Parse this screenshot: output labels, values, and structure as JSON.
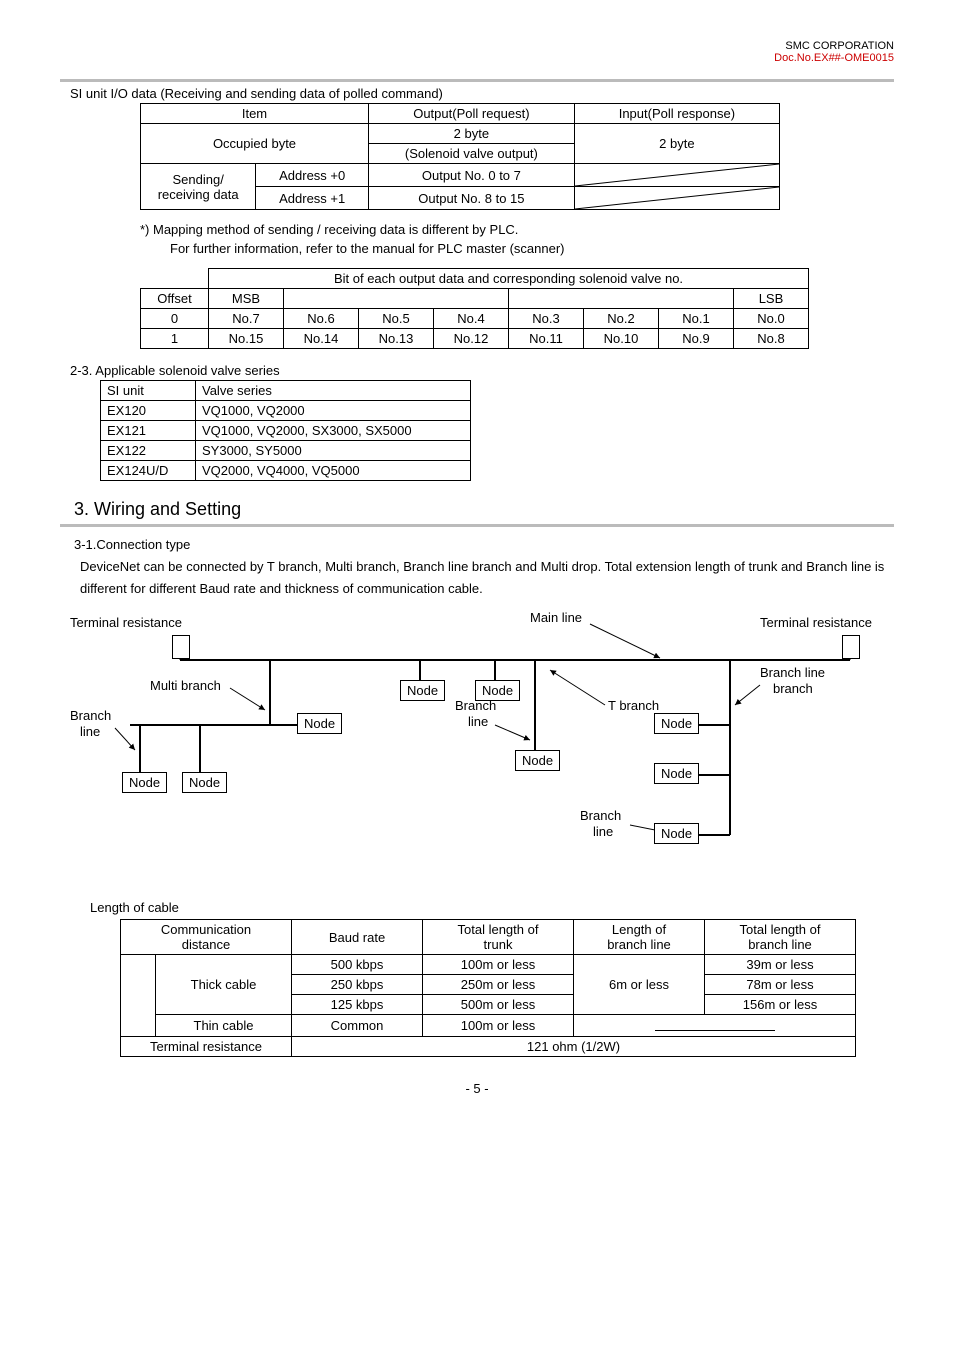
{
  "header": {
    "company": "SMC CORPORATION",
    "docno": "Doc.No.EX##-OME0015"
  },
  "si_unit_title": "SI unit I/O data (Receiving and sending data of polled command)",
  "tbl1": {
    "h_item": "Item",
    "h_out": "Output(Poll request)",
    "h_in": "Input(Poll response)",
    "occupied": "Occupied byte",
    "two_byte": "2 byte",
    "solenoid": "(Solenoid valve output)",
    "sending": "Sending/",
    "receiving": "receiving data",
    "addr0": "Address +0",
    "addr1": "Address +1",
    "out0": "Output No. 0 to 7",
    "out8": "Output No. 8 to 15"
  },
  "note1": "*) Mapping method of sending / receiving data is different by PLC.",
  "note2": "For further information, refer to the manual for PLC master (scanner)",
  "tbl2": {
    "caption": "Bit of each output data and corresponding solenoid valve no.",
    "offset": "Offset",
    "msb": "MSB",
    "lsb": "LSB",
    "r0": [
      "0",
      "No.7",
      "No.6",
      "No.5",
      "No.4",
      "No.3",
      "No.2",
      "No.1",
      "No.0"
    ],
    "r1": [
      "1",
      "No.15",
      "No.14",
      "No.13",
      "No.12",
      "No.11",
      "No.10",
      "No.9",
      "No.8"
    ]
  },
  "applicable_title": "2-3. Applicable solenoid valve series",
  "tbl3": {
    "h0": "SI unit",
    "h1": "Valve series",
    "rows": [
      [
        "EX120",
        "VQ1000, VQ2000"
      ],
      [
        "EX121",
        "VQ1000, VQ2000, SX3000, SX5000"
      ],
      [
        "EX122",
        "SY3000, SY5000"
      ],
      [
        "EX124U/D",
        "VQ2000, VQ4000, VQ5000"
      ]
    ]
  },
  "wiring_title": "3. Wiring and Setting",
  "conn_type": "3-1.Connection type",
  "conn_para": "DeviceNet can be connected by T branch, Multi branch, Branch line branch and Multi drop. Total extension length of trunk and Branch line is different for different Baud rate and thickness of communication cable.",
  "diagram": {
    "terminal_res": "Terminal resistance",
    "main_line": "Main line",
    "multi_branch": "Multi branch",
    "branch_line": "Branch",
    "branch_line2": "line",
    "t_branch": "T branch",
    "branch_line_branch": "Branch line",
    "branch_line_branch2": "branch",
    "node": "Node"
  },
  "len_title": "Length of cable",
  "tbl4": {
    "h_comm": "Communication",
    "h_dist": "distance",
    "h_baud": "Baud rate",
    "h_tot_trunk": "Total length of",
    "h_trunk": "trunk",
    "h_len_branch": "Length of",
    "h_branch_line": "branch line",
    "h_tot_branch": "Total length of",
    "h_tot_branch2": "branch line",
    "thick": "Thick cable",
    "thin": "Thin cable",
    "term_res": "Terminal resistance",
    "b500": "500 kbps",
    "b250": "250 kbps",
    "b125": "125 kbps",
    "common": "Common",
    "m100": "100m or less",
    "m250": "250m or less",
    "m500": "500m or less",
    "six": "6m or less",
    "m39": "39m or less",
    "m78": "78m or less",
    "m156": "156m or less",
    "ohm": "121 ohm (1/2W)"
  },
  "pagenum": "- 5 -"
}
